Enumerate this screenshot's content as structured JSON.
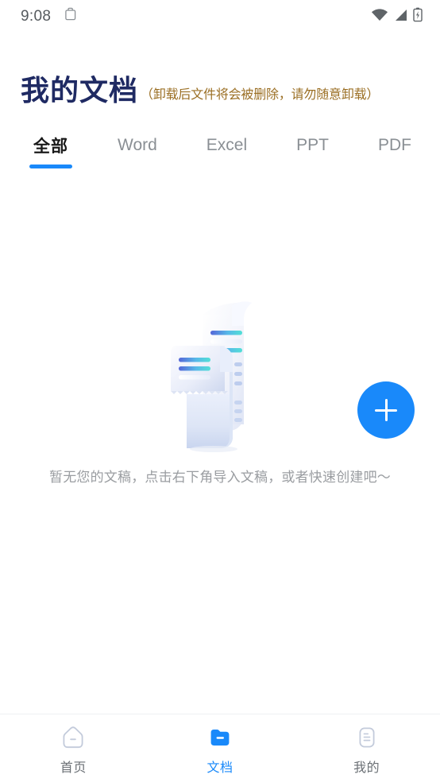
{
  "status_bar": {
    "time": "9:08",
    "icons": {
      "clipboard": "clipboard-icon",
      "wifi": "wifi-icon",
      "signal": "signal-icon",
      "battery": "battery-charging-icon"
    }
  },
  "header": {
    "title": "我的文档",
    "subtitle": "（卸载后文件将会被删除，请勿随意卸载）",
    "title_color": "#1F2A63",
    "subtitle_color": "#9B6F24"
  },
  "tabs": {
    "active_index": 0,
    "items": [
      {
        "label": "全部"
      },
      {
        "label": "Word"
      },
      {
        "label": "Excel"
      },
      {
        "label": "PPT"
      },
      {
        "label": "PDF"
      }
    ],
    "indicator_color": "#1989FA"
  },
  "empty_state": {
    "illustration": "documents-illustration",
    "message": "暂无您的文稿，点击右下角导入文稿，或者快速创建吧～"
  },
  "fab": {
    "icon": "plus-icon",
    "label": "+",
    "color": "#1989FA"
  },
  "bottom_nav": {
    "active_index": 1,
    "items": [
      {
        "label": "首页",
        "icon": "home-icon"
      },
      {
        "label": "文档",
        "icon": "folder-icon"
      },
      {
        "label": "我的",
        "icon": "profile-list-icon"
      }
    ],
    "active_color": "#1989FA",
    "inactive_color": "#6B7075"
  }
}
